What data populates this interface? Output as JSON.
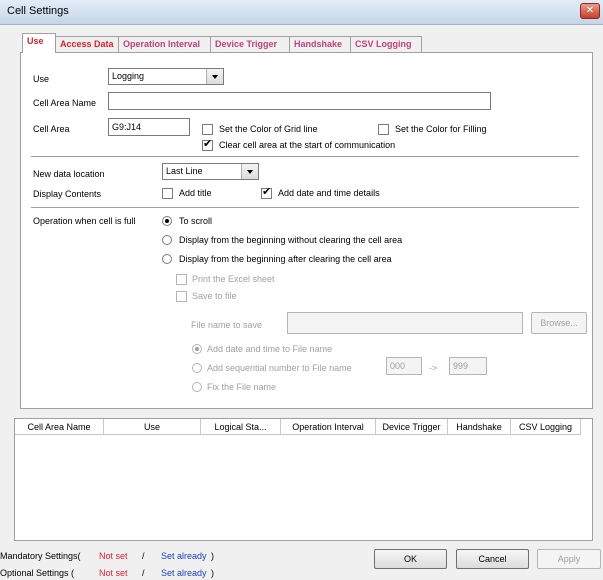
{
  "window": {
    "title": "Cell Settings",
    "close": "✕"
  },
  "tabs": [
    {
      "label": "Use",
      "color": "red"
    },
    {
      "label": "Access Data",
      "color": "red"
    },
    {
      "label": "Operation Interval",
      "color": "magenta"
    },
    {
      "label": "Device Trigger",
      "color": "magenta"
    },
    {
      "label": "Handshake",
      "color": "magenta"
    },
    {
      "label": "CSV Logging",
      "color": "magenta"
    }
  ],
  "use": {
    "use_label": "Use",
    "use_value": "Logging",
    "cell_area_name_label": "Cell Area Name",
    "cell_area_name_value": "",
    "cell_area_label": "Cell Area",
    "cell_area_value": "G9:J14",
    "grid_color_label": "Set the Color of Grid line",
    "fill_color_label": "Set the Color for Filling",
    "clear_label": "Clear cell area at the start of communication",
    "new_data_location_label": "New data location",
    "new_data_location_value": "Last Line",
    "display_contents_label": "Display Contents",
    "add_title_label": "Add title",
    "add_date_label": "Add date and time details",
    "operation_full_label": "Operation when cell is full",
    "radio_scroll": "To scroll",
    "radio_no_clear": "Display from the beginning without clearing the cell area",
    "radio_after_clear": "Display from the beginning after clearing the cell area",
    "print_excel": "Print the Excel sheet",
    "save_to_file": "Save to file",
    "file_name_label": "File name to save",
    "file_name_value": "",
    "browse": "Browse...",
    "file_add_date": "Add date and time to File name",
    "file_add_seq": "Add sequential number to File name",
    "seq_from": "000",
    "seq_arrow": "->",
    "seq_to": "999",
    "fix_name": "Fix the File name"
  },
  "table": {
    "columns": [
      "Cell Area Name",
      "Use",
      "Logical Sta...",
      "Operation Interval",
      "Device Trigger",
      "Handshake",
      "CSV Logging"
    ]
  },
  "legend": {
    "mandatory_label": "Mandatory Settings(",
    "optional_label": "Optional Settings  (",
    "not_set": "Not set",
    "slash": "/",
    "set_already": "Set already",
    "close_paren": ")",
    "not_set_color": "#e0212c",
    "set_already_color": "#1f3fbf"
  },
  "buttons": {
    "ok": "OK",
    "cancel": "Cancel",
    "apply": "Apply"
  }
}
